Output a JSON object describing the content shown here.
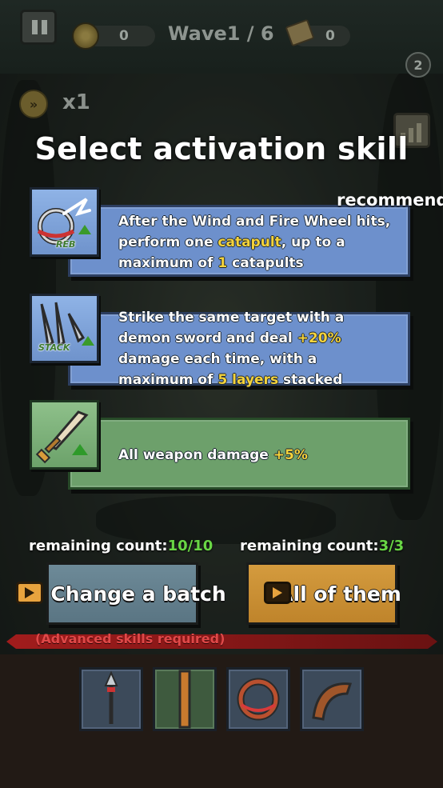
{
  "hud": {
    "coins": "0",
    "wave": "Wave1 / 6",
    "scrolls": "0",
    "badge": "2",
    "speed": "x1"
  },
  "title": "Select activation skill",
  "recommend_label": "recommend",
  "skills": [
    {
      "tag": "REB",
      "icon": "wind-fire-wheel-icon",
      "text": {
        "p1": "After the Wind and Fire Wheel hits,",
        "p2": "perform one ",
        "p3": "catapult",
        "p4": ", up to a",
        "p5": "maximum of ",
        "p6": "1",
        "p7": " catapults"
      }
    },
    {
      "tag": "STACK",
      "icon": "demon-sword-icon",
      "text": {
        "p1": "Strike the same target with a",
        "p2": "demon sword and deal ",
        "p3": "+20%",
        "p4": "damage each time, with a",
        "p5": "maximum of ",
        "p6": "5 layers",
        "p7": " stacked"
      }
    },
    {
      "icon": "sword-upgrade-icon",
      "text": {
        "p1": "All weapon damage ",
        "p2": "+5%"
      }
    }
  ],
  "remaining": [
    {
      "label": "remaining count:",
      "value": "10/10"
    },
    {
      "label": "remaining count:",
      "value": "3/3"
    }
  ],
  "buttons": {
    "change": "Change a batch",
    "all": "All of them"
  },
  "advanced_note": "(Advanced skills required)",
  "equipment_slots": [
    "spear-icon",
    "staff-icon",
    "wheel-icon",
    "boomerang-icon"
  ],
  "colors": {
    "highlight": "#f5d33b",
    "count_green": "#69d645",
    "card_blue": "#6d90cc",
    "card_green": "#6da06b",
    "button_change": "#6d8a98",
    "button_all": "#d49b3e",
    "advanced_red": "#e04848"
  }
}
